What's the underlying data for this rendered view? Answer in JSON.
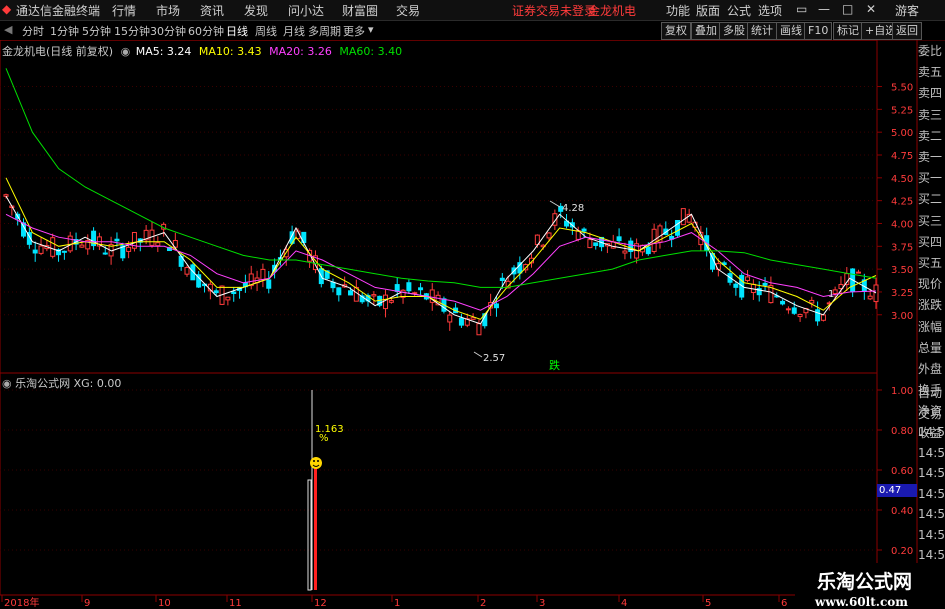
{
  "titlebar": {
    "app_title": "通达信金融终端",
    "menu": [
      "行情",
      "市场",
      "资讯",
      "发现",
      "问小达",
      "财富圈",
      "交易"
    ],
    "warning": "证券交易未登录",
    "stock_name": "金龙机电",
    "right_menu": [
      "功能",
      "版面",
      "公式",
      "选项"
    ],
    "user": "游客"
  },
  "toolbar": {
    "periods": [
      "分时",
      "1分钟",
      "5分钟",
      "15分钟",
      "30分钟",
      "60分钟",
      "日线",
      "周线",
      "月线",
      "多周期",
      "更多"
    ],
    "active_period": "日线",
    "buttons": [
      "复权",
      "叠加",
      "多股",
      "统计",
      "画线",
      "F10",
      "标记",
      "+自选",
      "返回"
    ]
  },
  "main_chart": {
    "header": "金龙机电(日线 前复权)",
    "ma_labels": [
      {
        "text": "MA5: 3.24",
        "color": "#ffffff"
      },
      {
        "text": "MA10: 3.43",
        "color": "#ffff00"
      },
      {
        "text": "MA20: 3.26",
        "color": "#ff40ff"
      },
      {
        "text": "MA60: 3.40",
        "color": "#00e000"
      }
    ],
    "high_label": "4.28",
    "low_label": "2.57",
    "marker": "跌",
    "right_note": "1"
  },
  "indicator_chart": {
    "header": "乐淘公式网  XG: 0.00",
    "value_label": "1.163",
    "percent_label": "%",
    "current_value": "0.47"
  },
  "chart_data": [
    {
      "type": "line",
      "title": "金龙机电(日线 前复权)",
      "y_ticks": [
        5.5,
        5.25,
        5.0,
        4.75,
        4.5,
        4.25,
        4.0,
        3.75,
        3.5,
        3.25,
        3.0
      ],
      "ylim": [
        2.45,
        5.9
      ],
      "x_ticks": [
        "2018年",
        "9",
        "10",
        "11",
        "12",
        "1",
        "2",
        "3",
        "4",
        "5",
        "6"
      ],
      "series": [
        {
          "name": "MA5",
          "color": "#ffffff",
          "values": [
            4.3,
            3.8,
            3.7,
            3.85,
            3.7,
            3.8,
            3.9,
            3.5,
            3.2,
            3.3,
            3.4,
            3.95,
            3.4,
            3.3,
            3.1,
            3.25,
            3.2,
            3.0,
            2.9,
            3.4,
            3.7,
            4.1,
            3.85,
            3.75,
            3.7,
            3.9,
            4.1,
            3.5,
            3.3,
            3.25,
            3.1,
            3.0,
            3.4,
            3.24
          ]
        },
        {
          "name": "MA10",
          "color": "#ffff00",
          "values": [
            4.5,
            3.9,
            3.75,
            3.8,
            3.75,
            3.8,
            3.8,
            3.6,
            3.3,
            3.3,
            3.4,
            3.85,
            3.5,
            3.35,
            3.15,
            3.2,
            3.2,
            3.05,
            2.95,
            3.3,
            3.6,
            3.95,
            3.9,
            3.8,
            3.7,
            3.85,
            4.0,
            3.6,
            3.35,
            3.3,
            3.2,
            3.05,
            3.3,
            3.43
          ]
        },
        {
          "name": "MA20",
          "color": "#ff40ff",
          "values": [
            4.1,
            3.95,
            3.85,
            3.8,
            3.8,
            3.75,
            3.75,
            3.65,
            3.45,
            3.35,
            3.4,
            3.7,
            3.6,
            3.45,
            3.3,
            3.25,
            3.2,
            3.15,
            3.05,
            3.2,
            3.45,
            3.75,
            3.85,
            3.8,
            3.75,
            3.8,
            3.9,
            3.7,
            3.45,
            3.35,
            3.3,
            3.2,
            3.25,
            3.26
          ]
        },
        {
          "name": "MA60",
          "color": "#00e000",
          "values": [
            5.7,
            5.0,
            4.6,
            4.4,
            4.25,
            4.1,
            3.95,
            3.85,
            3.75,
            3.65,
            3.6,
            3.6,
            3.55,
            3.5,
            3.45,
            3.4,
            3.37,
            3.35,
            3.3,
            3.3,
            3.35,
            3.4,
            3.45,
            3.5,
            3.6,
            3.65,
            3.7,
            3.7,
            3.68,
            3.6,
            3.55,
            3.5,
            3.45,
            3.4
          ]
        }
      ]
    },
    {
      "type": "bar",
      "title": "乐淘公式网  XG: 0.00",
      "y_ticks": [
        1.0,
        0.8,
        0.6,
        0.4,
        0.2
      ],
      "ylim": [
        0,
        1.0
      ],
      "series": [
        {
          "name": "XG",
          "values": [
            {
              "x": "12",
              "value": 1.0
            }
          ]
        }
      ]
    }
  ],
  "right_panel": {
    "labels": [
      "委比",
      "卖五",
      "卖四",
      "卖三",
      "卖二",
      "卖一",
      "买一",
      "买二",
      "买三",
      "买四",
      "买五",
      "现价",
      "涨跌",
      "涨幅",
      "总量",
      "外盘",
      "换手",
      "净资",
      "收益"
    ],
    "lower": [
      "自动",
      "交易",
      "14:56",
      "14:56",
      "14:56",
      "14:56",
      "14:56",
      "14:56",
      "14:56",
      "14:56"
    ]
  },
  "watermark": {
    "cn": "乐淘公式网",
    "url": "www.60lt.com"
  }
}
